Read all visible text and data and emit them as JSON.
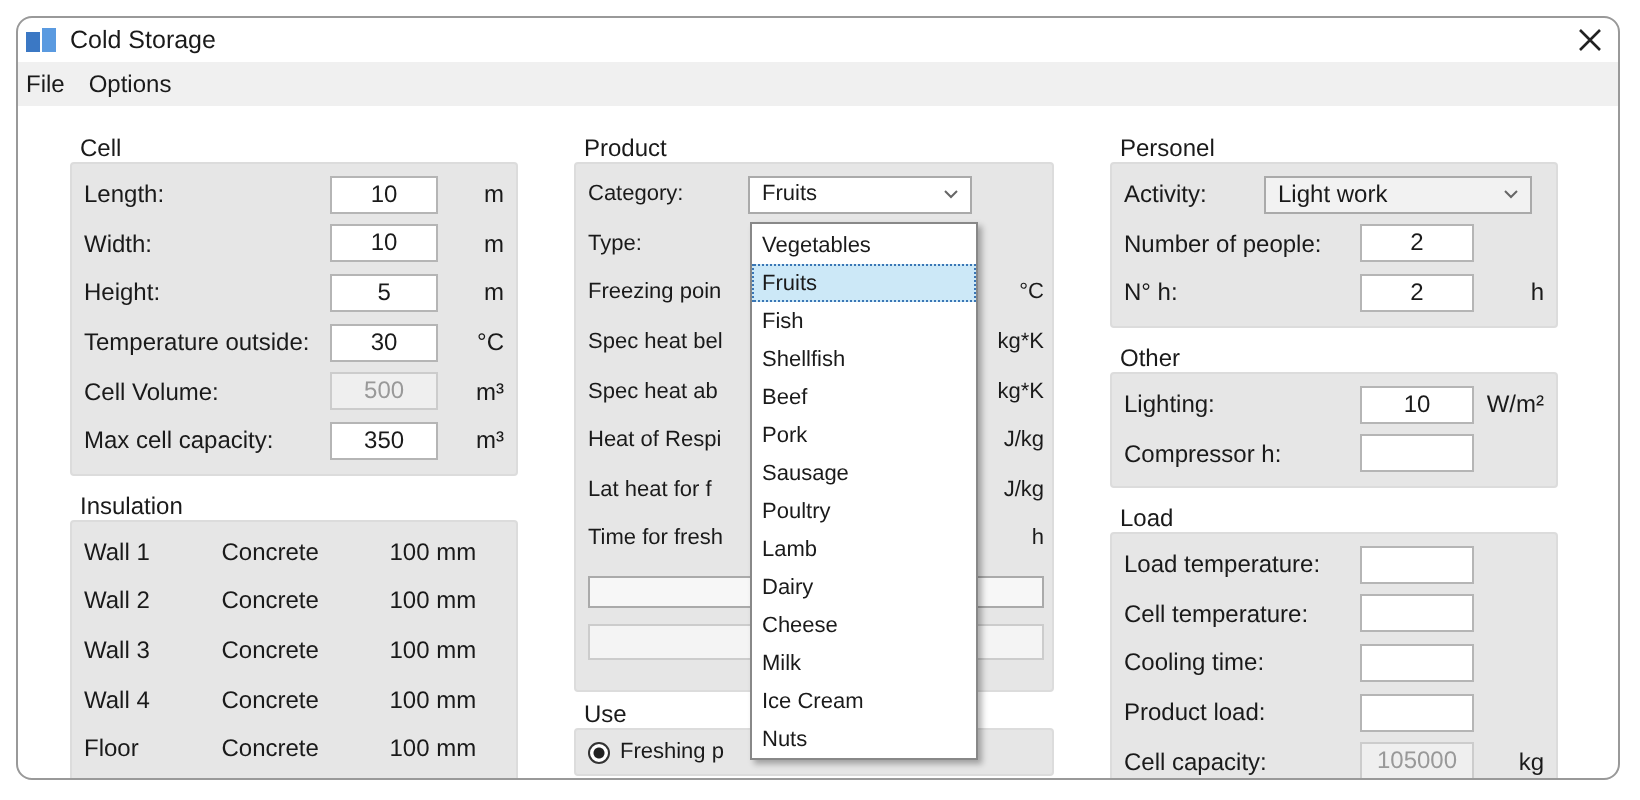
{
  "window": {
    "title": "Cold Storage"
  },
  "menu": [
    "File",
    "Options"
  ],
  "cell": {
    "title": "Cell",
    "rows": [
      {
        "label": "Length:",
        "value": "10",
        "unit": "m",
        "disabled": false
      },
      {
        "label": "Width:",
        "value": "10",
        "unit": "m",
        "disabled": false
      },
      {
        "label": "Height:",
        "value": "5",
        "unit": "m",
        "disabled": false
      },
      {
        "label": "Temperature outside:",
        "value": "30",
        "unit": "°C",
        "disabled": false
      },
      {
        "label": "Cell Volume:",
        "value": "500",
        "unit": "m³",
        "disabled": true
      },
      {
        "label": "Max cell capacity:",
        "value": "350",
        "unit": "m³",
        "disabled": false
      }
    ]
  },
  "insulation": {
    "title": "Insulation",
    "rows": [
      {
        "wall": "Wall 1",
        "material": "Concrete",
        "thickness": "100 mm"
      },
      {
        "wall": "Wall 2",
        "material": "Concrete",
        "thickness": "100 mm"
      },
      {
        "wall": "Wall 3",
        "material": "Concrete",
        "thickness": "100 mm"
      },
      {
        "wall": "Wall 4",
        "material": "Concrete",
        "thickness": "100 mm"
      },
      {
        "wall": "Floor",
        "material": "Concrete",
        "thickness": "100 mm"
      }
    ]
  },
  "product": {
    "title": "Product",
    "category_label": "Category:",
    "category_value": "Fruits",
    "type_label": "Type:",
    "properties": [
      {
        "label": "Freezing poin",
        "unit": "°C"
      },
      {
        "label": "Spec heat bel",
        "unit": "kg*K"
      },
      {
        "label": "Spec heat ab",
        "unit": "kg*K"
      },
      {
        "label": "Heat of Respi",
        "unit": "J/kg"
      },
      {
        "label": "Lat heat for f",
        "unit": "J/kg"
      },
      {
        "label": "Time for fresh",
        "unit": "h"
      }
    ],
    "dropdown": [
      {
        "label": "Vegetables",
        "selected": false
      },
      {
        "label": "Fruits",
        "selected": true
      },
      {
        "label": "Fish",
        "selected": false
      },
      {
        "label": "Shellfish",
        "selected": false
      },
      {
        "label": "Beef",
        "selected": false
      },
      {
        "label": "Pork",
        "selected": false
      },
      {
        "label": "Sausage",
        "selected": false
      },
      {
        "label": "Poultry",
        "selected": false
      },
      {
        "label": "Lamb",
        "selected": false
      },
      {
        "label": "Dairy",
        "selected": false
      },
      {
        "label": "Cheese",
        "selected": false
      },
      {
        "label": "Milk",
        "selected": false
      },
      {
        "label": "Ice Cream",
        "selected": false
      },
      {
        "label": "Nuts",
        "selected": false
      }
    ],
    "use": {
      "title": "Use",
      "options": [
        {
          "label": "Freshing p",
          "selected": true
        }
      ]
    }
  },
  "personel": {
    "title": "Personel",
    "activity_label": "Activity:",
    "activity_value": "Light work",
    "rows": [
      {
        "label": "Number of people:",
        "value": "2",
        "unit": ""
      },
      {
        "label": "N° h:",
        "value": "2",
        "unit": "h"
      }
    ]
  },
  "other": {
    "title": "Other",
    "rows": [
      {
        "label": "Lighting:",
        "value": "10",
        "unit": "W/m²"
      },
      {
        "label": "Compressor h:",
        "value": "",
        "unit": ""
      }
    ]
  },
  "load": {
    "title": "Load",
    "rows": [
      {
        "label": "Load temperature:",
        "value": "",
        "unit": "",
        "disabled": false
      },
      {
        "label": "Cell temperature:",
        "value": "",
        "unit": "",
        "disabled": false
      },
      {
        "label": "Cooling time:",
        "value": "",
        "unit": "",
        "disabled": false
      },
      {
        "label": "Product load:",
        "value": "",
        "unit": "",
        "disabled": false
      },
      {
        "label": "Cell capacity:",
        "value": "105000",
        "unit": "kg",
        "disabled": true
      }
    ]
  }
}
